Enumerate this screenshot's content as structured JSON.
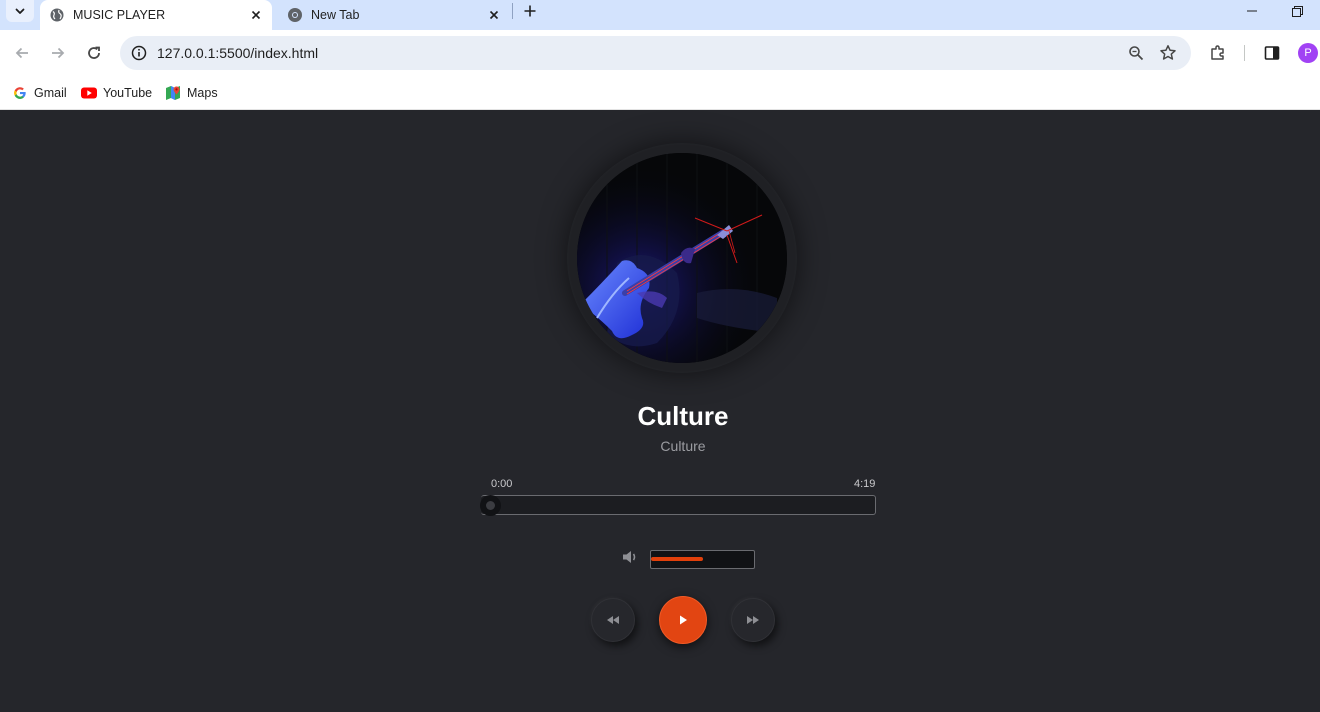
{
  "browser": {
    "tabs": [
      {
        "title": "MUSIC PLAYER",
        "active": true,
        "icon": "globe-icon"
      },
      {
        "title": "New Tab",
        "active": false,
        "icon": "chrome-icon"
      }
    ],
    "url": "127.0.0.1:5500/index.html",
    "profile_initial": "P",
    "bookmarks": [
      {
        "label": "Gmail",
        "icon": "google-icon"
      },
      {
        "label": "YouTube",
        "icon": "youtube-icon"
      },
      {
        "label": "Maps",
        "icon": "maps-icon"
      }
    ]
  },
  "player": {
    "title": "Culture",
    "artist": "Culture",
    "current_time": "0:00",
    "duration": "4:19",
    "progress_fraction": 0,
    "volume_fraction": 0.5,
    "colors": {
      "accent": "#e2400b",
      "background": "#25262b"
    }
  }
}
